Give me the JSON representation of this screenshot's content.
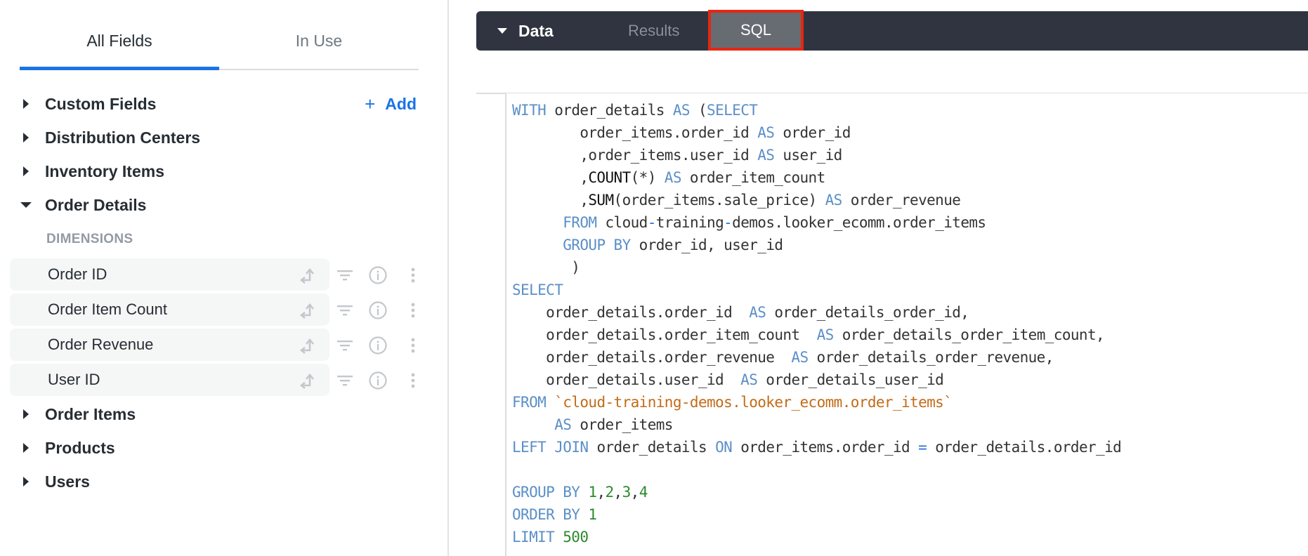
{
  "left_panel": {
    "tabs": [
      {
        "label": "All Fields",
        "active": true
      },
      {
        "label": "In Use",
        "active": false
      }
    ],
    "add_label": "Add",
    "add_icon": "plus-icon",
    "groups_before": [
      {
        "label": "Custom Fields",
        "expanded": false
      },
      {
        "label": "Distribution Centers",
        "expanded": false
      },
      {
        "label": "Inventory Items",
        "expanded": false
      }
    ],
    "expanded_group": {
      "label": "Order Details",
      "section_header": "DIMENSIONS",
      "fields": [
        {
          "label": "Order ID"
        },
        {
          "label": "Order Item Count"
        },
        {
          "label": "Order Revenue"
        },
        {
          "label": "User ID"
        }
      ],
      "field_icons": [
        "pivot-icon",
        "filter-icon",
        "info-icon",
        "more-vert-icon"
      ]
    },
    "groups_after": [
      {
        "label": "Order Items",
        "expanded": false
      },
      {
        "label": "Products",
        "expanded": false
      },
      {
        "label": "Users",
        "expanded": false
      }
    ]
  },
  "toolbar": {
    "data_label": "Data",
    "results_label": "Results",
    "sql_label": "SQL",
    "active_tab": "SQL",
    "highlight_color": "#e8260f"
  },
  "sql_editor": {
    "lines": [
      "WITH order_details AS (SELECT",
      "        order_items.order_id AS order_id",
      "        ,order_items.user_id AS user_id",
      "        ,COUNT(*) AS order_item_count",
      "        ,SUM(order_items.sale_price) AS order_revenue",
      "      FROM cloud-training-demos.looker_ecomm.order_items",
      "      GROUP BY order_id, user_id",
      "       )",
      "SELECT",
      "    order_details.order_id  AS order_details_order_id,",
      "    order_details.order_item_count  AS order_details_order_item_count,",
      "    order_details.order_revenue  AS order_details_order_revenue,",
      "    order_details.user_id  AS order_details_user_id",
      "FROM `cloud-training-demos.looker_ecomm.order_items`",
      "     AS order_items",
      "LEFT JOIN order_details ON order_items.order_id = order_details.order_id",
      "",
      "GROUP BY 1,2,3,4",
      "ORDER BY 1",
      "LIMIT 500"
    ]
  },
  "colors": {
    "accent": "#1a73e8",
    "toolbar_bg": "#2f3440",
    "sql_keyword": "#5b8fc7",
    "sql_string": "#c36b17",
    "sql_number": "#2d8a2d"
  }
}
